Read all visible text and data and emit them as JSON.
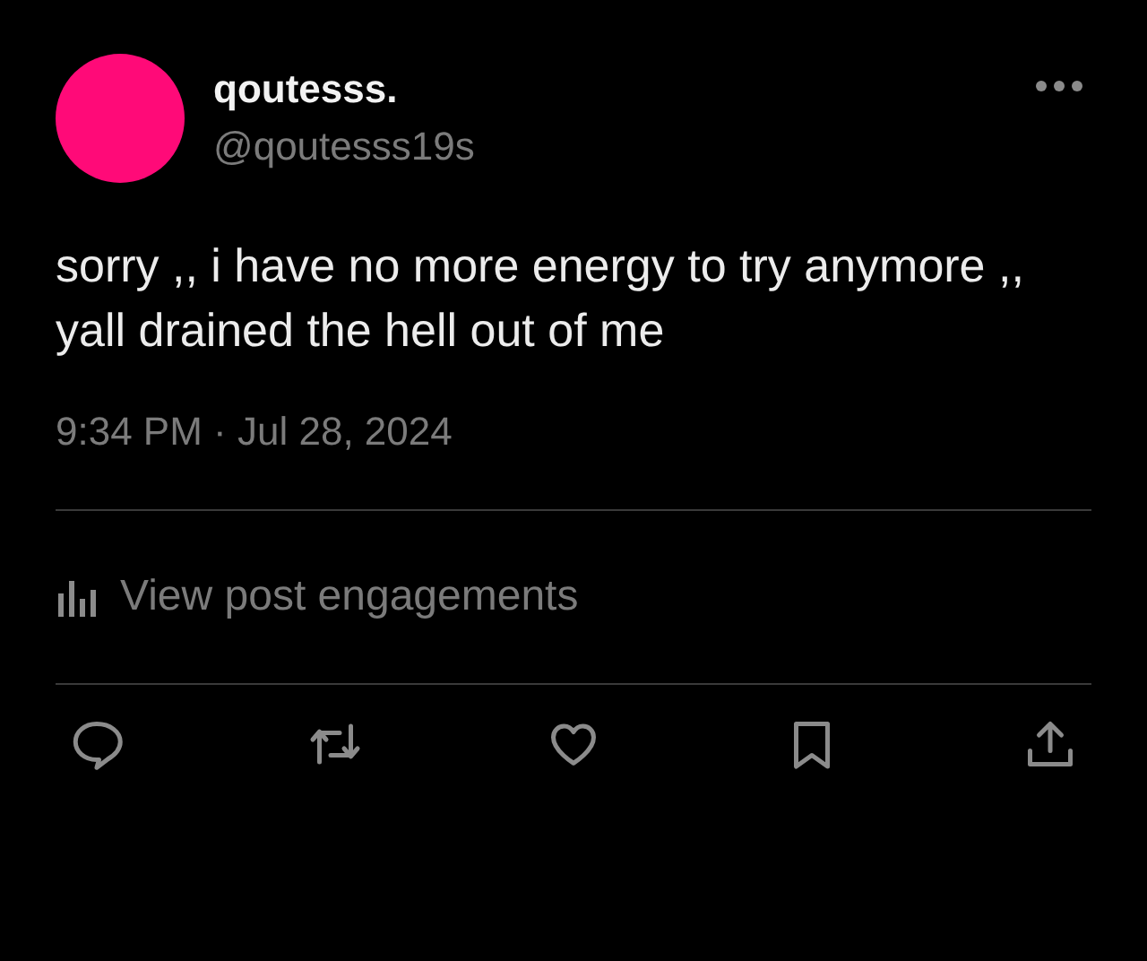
{
  "author": {
    "name": "qoutesss.",
    "handle": "@qoutesss19s",
    "color": "#ff0a78"
  },
  "post": {
    "text": "sorry ,, i have no more energy to try anymore ,, yall drained the hell out of me",
    "timestamp": "9:34 PM · Jul 28, 2024"
  },
  "engagements": {
    "label": "View post engagements"
  },
  "actions": [
    {
      "kind": "reply"
    },
    {
      "kind": "repost"
    },
    {
      "kind": "like"
    },
    {
      "kind": "bookmark"
    },
    {
      "kind": "share"
    }
  ]
}
